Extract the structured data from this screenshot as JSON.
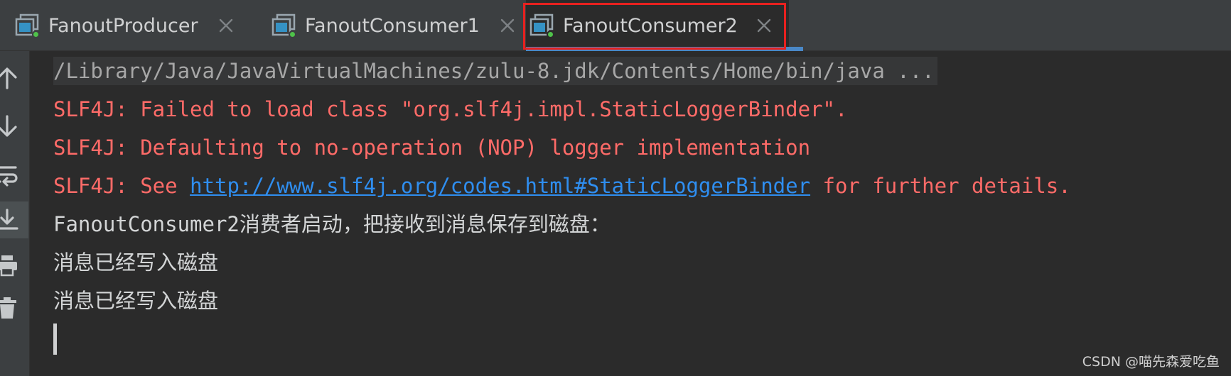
{
  "tabs": [
    {
      "label": "FanoutProducer",
      "active": false
    },
    {
      "label": "FanoutConsumer1",
      "active": false
    },
    {
      "label": "FanoutConsumer2",
      "active": true
    }
  ],
  "toolbar": {
    "icons": [
      "arrow-up-icon",
      "arrow-down-icon",
      "soft-wrap-icon",
      "scroll-to-end-icon",
      "print-icon",
      "trash-icon"
    ]
  },
  "console": {
    "command_line": "/Library/Java/JavaVirtualMachines/zulu-8.jdk/Contents/Home/bin/java ...",
    "error_line_1": "SLF4J: Failed to load class \"org.slf4j.impl.StaticLoggerBinder\".",
    "error_line_2": "SLF4J: Defaulting to no-operation (NOP) logger implementation",
    "error_line_3_prefix": "SLF4J: See ",
    "error_line_3_link": "http://www.slf4j.org/codes.html#StaticLoggerBinder",
    "error_line_3_suffix": " for further details.",
    "output_line_1": "FanoutConsumer2消费者启动，把接收到消息保存到磁盘：",
    "output_line_2": "消息已经写入磁盘",
    "output_line_3": "消息已经写入磁盘"
  },
  "watermark": "CSDN @喵先森爱吃鱼",
  "colors": {
    "background": "#2b2b2b",
    "tabbar": "#3c3f41",
    "error": "#ff6b68",
    "link": "#2f8ef0",
    "active_underline": "#4a88c7",
    "highlight": "#e8211f"
  }
}
